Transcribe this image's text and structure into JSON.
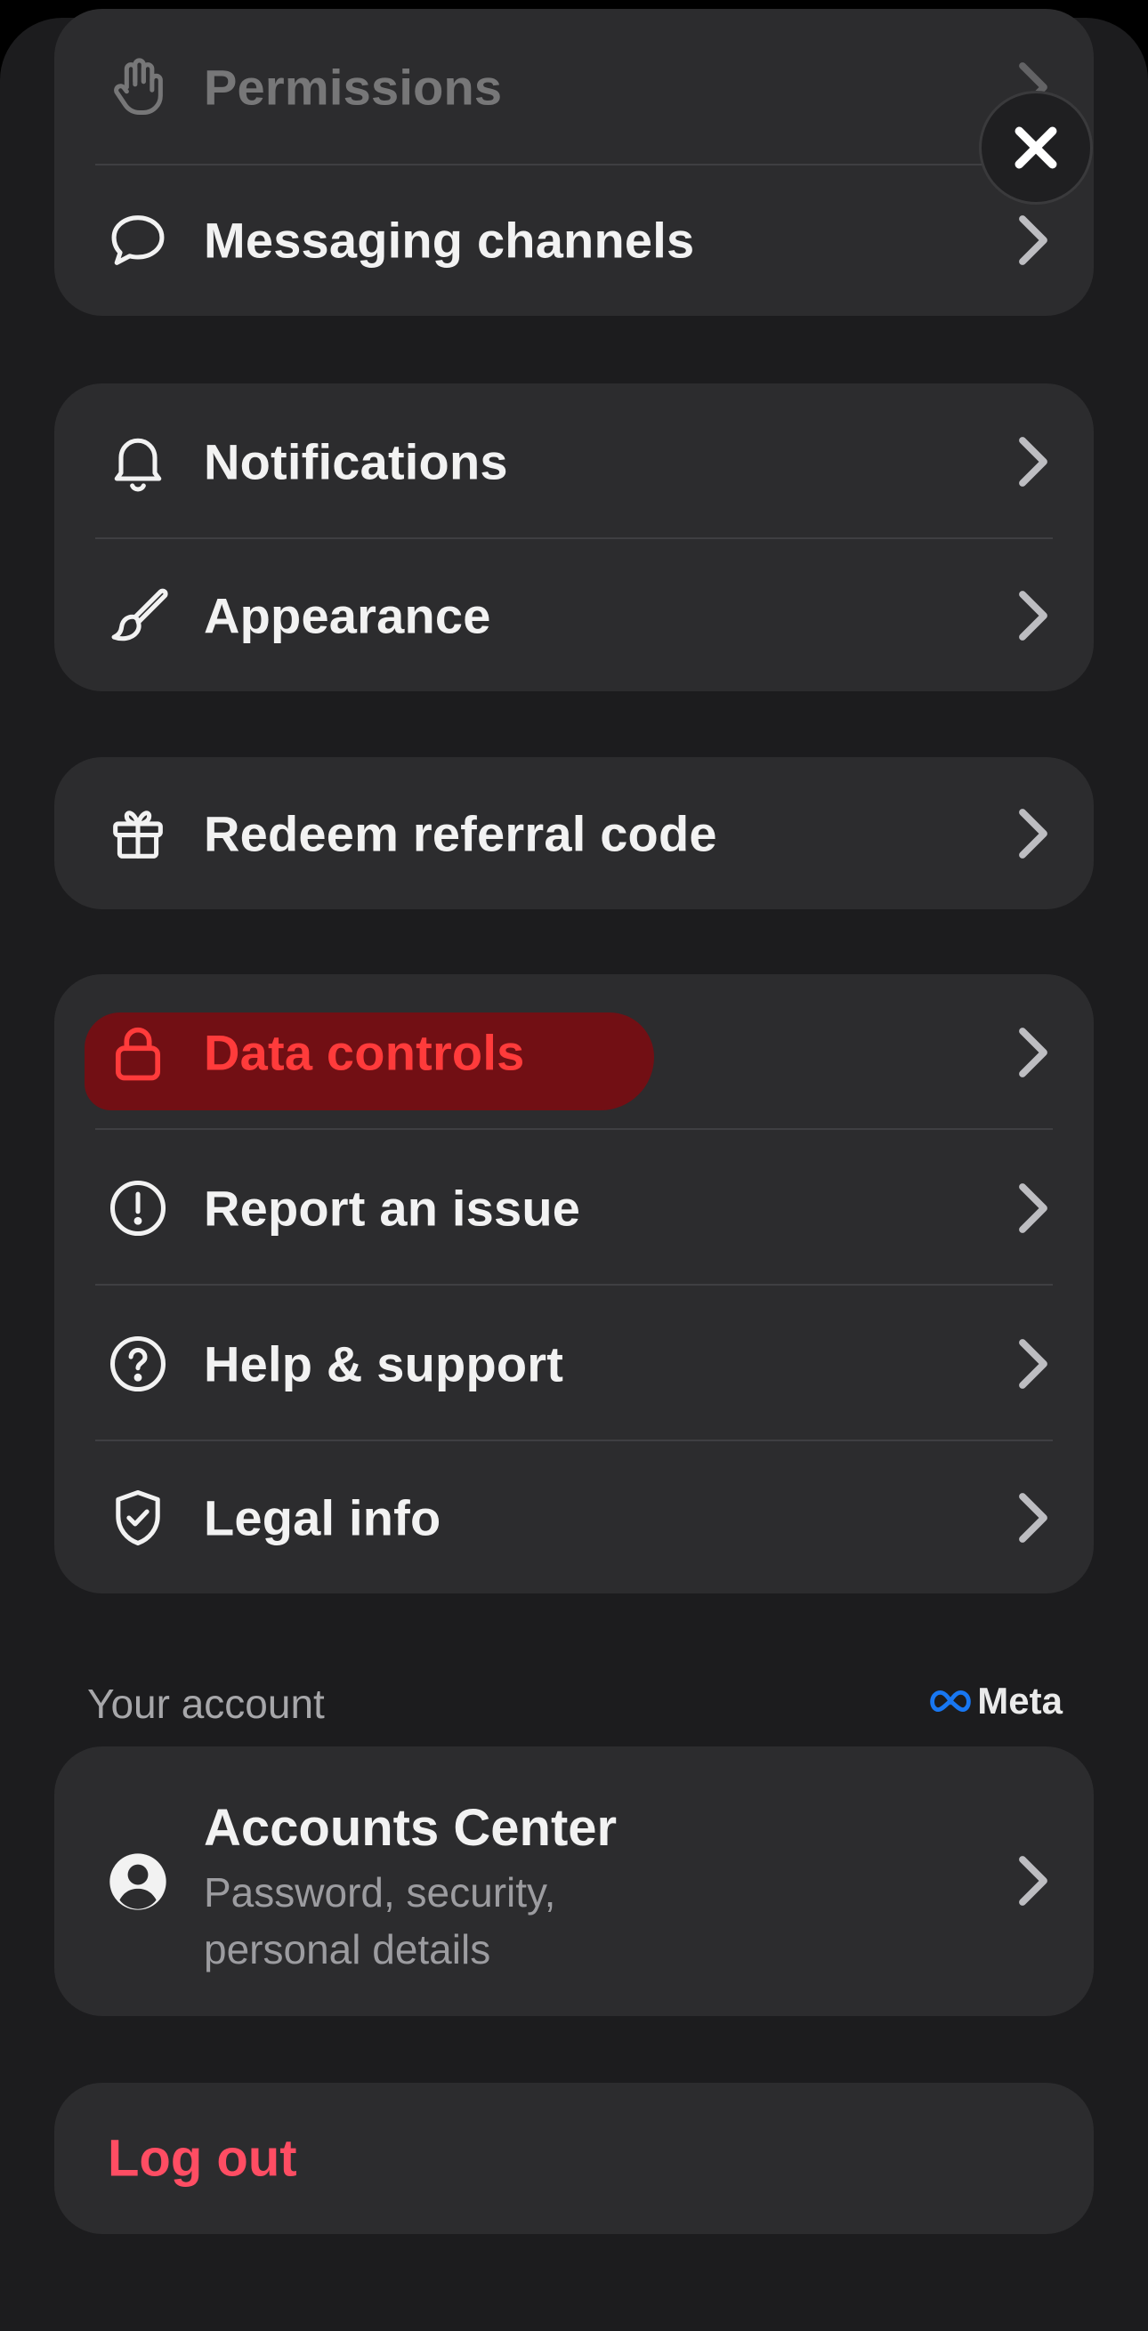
{
  "close_label": "Close",
  "cards": {
    "top": {
      "items": [
        {
          "label": "Permissions",
          "icon": "hand-icon"
        },
        {
          "label": "Messaging channels",
          "icon": "chat-bubble-icon"
        }
      ]
    },
    "prefs": {
      "items": [
        {
          "label": "Notifications",
          "icon": "bell-icon"
        },
        {
          "label": "Appearance",
          "icon": "paintbrush-icon"
        }
      ]
    },
    "referral": {
      "items": [
        {
          "label": "Redeem referral code",
          "icon": "gift-icon"
        }
      ]
    },
    "support": {
      "items": [
        {
          "label": "Data controls",
          "icon": "lock-icon",
          "color": "#ff3b3b"
        },
        {
          "label": "Report an issue",
          "icon": "exclamation-circle-icon"
        },
        {
          "label": "Help & support",
          "icon": "question-circle-icon"
        },
        {
          "label": "Legal info",
          "icon": "shield-check-icon"
        }
      ]
    }
  },
  "account": {
    "section_title": "Your account",
    "meta_label": "Meta",
    "accounts_center": {
      "title": "Accounts Center",
      "subtitle": "Password, security, personal details",
      "icon": "person-circle-icon"
    }
  },
  "logout_label": "Log out",
  "colors": {
    "background": "#1c1c1e",
    "card": "#2c2c2e",
    "logout": "#ff4d63",
    "highlight": "#ff3b3b",
    "meta_blue": "#1877f2"
  }
}
